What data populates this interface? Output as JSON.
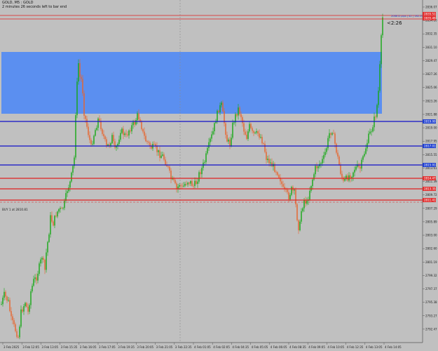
{
  "header": {
    "symbol_line": "GOLD, M5 : GOLD",
    "timer_line": "2 minutes 26 seconds left to bar end"
  },
  "countdown": "<2:26",
  "spread_label": "2086 D pips | 42 | 182.20",
  "buy_label": "BUY 1 at 2810.81",
  "price_axis": {
    "ticks": [
      "2836.07",
      "2834.10",
      "2832.35",
      "2831.10",
      "2829.47",
      "2827.26",
      "2825.06",
      "2823.26",
      "2821.88",
      "2819.00",
      "2817.95",
      "2815.55",
      "2813.61",
      "2811.39",
      "2809.72",
      "2807.29",
      "2805.89",
      "2803.00",
      "2802.60",
      "2801.19",
      "2799.32",
      "2797.37",
      "2795.38",
      "2793.27",
      "2792.47"
    ],
    "badges": [
      {
        "text": "2835.51",
        "color": "#e03030"
      },
      {
        "text": "2835.49",
        "color": "#e03030"
      },
      {
        "text": "2819.00",
        "color": "#2040d0"
      },
      {
        "text": "2817.01",
        "color": "#2040d0"
      },
      {
        "text": "2815.91",
        "color": "#2040d0"
      },
      {
        "text": "2814.47",
        "color": "#e03030"
      },
      {
        "text": "2813.35",
        "color": "#e03030"
      },
      {
        "text": "2811.41",
        "color": "#e03030"
      }
    ]
  },
  "time_axis": [
    "3 Feb 2025",
    "3 Feb 12:05",
    "3 Feb 13:05",
    "3 Feb 15:35",
    "3 Feb 16:05",
    "3 Feb 17:05",
    "3 Feb 19:35",
    "3 Feb 20:05",
    "3 Feb 21:05",
    "3 Feb 22:35",
    "4 Feb 01:05",
    "4 Feb 02:05",
    "4 Feb 04:35",
    "4 Feb 05:05",
    "4 Feb 06:05",
    "4 Feb 08:35",
    "4 Feb 09:05",
    "4 Feb 10:05",
    "4 Feb 12:35",
    "4 Feb 13:05",
    "4 Feb 14:05"
  ],
  "colors": {
    "background": "#c0c0c0",
    "bull_candle": "#12a812",
    "bear_candle": "#e8622a",
    "zone": "#5b8ff0",
    "blue_level": "#1010c8",
    "red_level": "#e02020"
  }
}
